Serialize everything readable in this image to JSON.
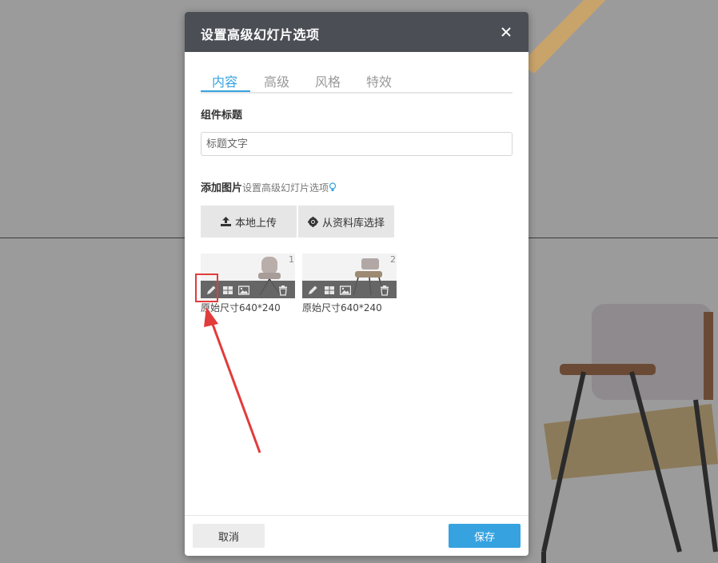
{
  "modal": {
    "title": "设置高级幻灯片选项",
    "tabs": [
      {
        "label": "内容",
        "active": true
      },
      {
        "label": "高级",
        "active": false
      },
      {
        "label": "风格",
        "active": false
      },
      {
        "label": "特效",
        "active": false
      }
    ],
    "widget_title_label": "组件标题",
    "widget_title_input": {
      "value": "",
      "placeholder": "标题文字"
    },
    "add_image_label": "添加图片",
    "add_image_hint": "设置高级幻灯片选项",
    "upload_local_label": "本地上传",
    "choose_library_label": "从资料库选择",
    "images": [
      {
        "index": "1",
        "size_text": "原始尺寸640*240"
      },
      {
        "index": "2",
        "size_text": "原始尺寸640*240"
      }
    ],
    "cancel_label": "取消",
    "save_label": "保存"
  },
  "colors": {
    "accent": "#36a2e0",
    "header_bg": "#4b4e55",
    "annotation": "#e23b3b"
  }
}
